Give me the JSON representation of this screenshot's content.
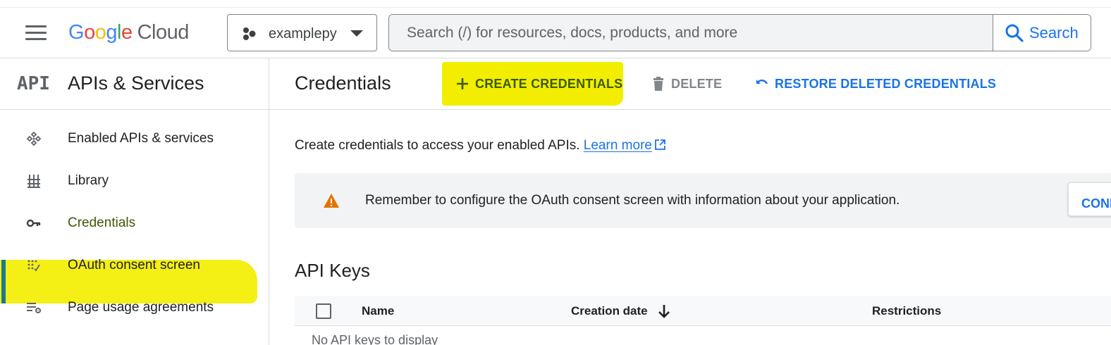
{
  "header": {
    "logo": {
      "word": "Google",
      "product": "Cloud",
      "colors": {
        "blue": "#4285f4",
        "red": "#ea4335",
        "yellow": "#fbbc04",
        "green": "#34a853"
      }
    },
    "project_name": "examplepy",
    "search_placeholder": "Search (/) for resources, docs, products, and more",
    "search_button": "Search"
  },
  "sidebar": {
    "logo_text": "API",
    "title": "APIs & Services",
    "items": [
      {
        "label": "Enabled APIs & services",
        "icon": "api-nodes-icon",
        "active": false
      },
      {
        "label": "Library",
        "icon": "library-icon",
        "active": false
      },
      {
        "label": "Credentials",
        "icon": "key-icon",
        "active": true,
        "highlighted": true
      },
      {
        "label": "OAuth consent screen",
        "icon": "oauth-dots-icon",
        "active": false
      },
      {
        "label": "Page usage agreements",
        "icon": "settings-list-icon",
        "active": false
      }
    ]
  },
  "toolbar": {
    "title": "Credentials",
    "create_label": "CREATE CREDENTIALS",
    "delete_label": "DELETE",
    "restore_label": "RESTORE DELETED CREDENTIALS"
  },
  "content": {
    "intro_text": "Create credentials to access your enabled APIs.",
    "learn_more": "Learn more",
    "banner_text": "Remember to configure the OAuth consent screen with information about your application.",
    "banner_button": "CONFIGURE CONSENT SCREEN",
    "section_title": "API Keys",
    "table_headers": [
      "Name",
      "Creation date",
      "Restrictions"
    ],
    "empty_message": "No API keys to display"
  },
  "colors": {
    "accent": "#1a73e8",
    "highlight": "#f3ee00",
    "warning": "#e37400"
  }
}
